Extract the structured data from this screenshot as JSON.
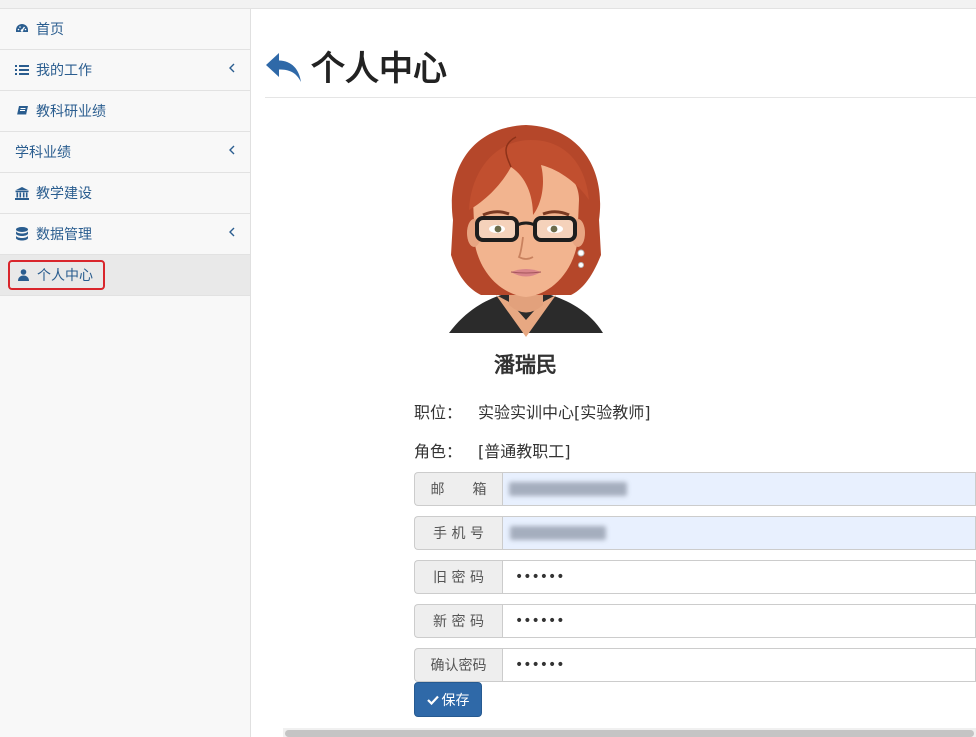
{
  "sidebar": {
    "items": [
      {
        "label": "首页",
        "icon": "dashboard-icon"
      },
      {
        "label": "我的工作",
        "icon": "list-icon",
        "has_submenu": true
      },
      {
        "label": "教科研业绩",
        "icon": "book-icon"
      },
      {
        "label": "学科业绩",
        "has_submenu": true
      },
      {
        "label": "教学建设",
        "icon": "bank-icon"
      },
      {
        "label": "数据管理",
        "icon": "database-icon",
        "has_submenu": true
      },
      {
        "label": "个人中心",
        "icon": "user-icon",
        "active": true
      }
    ]
  },
  "header": {
    "title": "个人中心",
    "back_icon": "reply-arrow-icon"
  },
  "profile": {
    "name": "潘瑞民",
    "position_label": "职位：",
    "position_value": "实验实训中心[实验教师]",
    "role_label": "角色：",
    "role_value": "[普通教职工]"
  },
  "form": {
    "email_label": "邮　　箱",
    "phone_label": "手 机 号",
    "old_password_label": "旧 密 码",
    "old_password_value": "••••••",
    "new_password_label": "新 密 码",
    "new_password_value": "••••••",
    "confirm_password_label": "确认密码",
    "confirm_password_value": "••••••",
    "save_label": "保存"
  },
  "colors": {
    "accent": "#2f69a8",
    "nav_text": "#2a5d8f",
    "highlight": "#d9262c",
    "autofill": "#e8f0fe"
  }
}
